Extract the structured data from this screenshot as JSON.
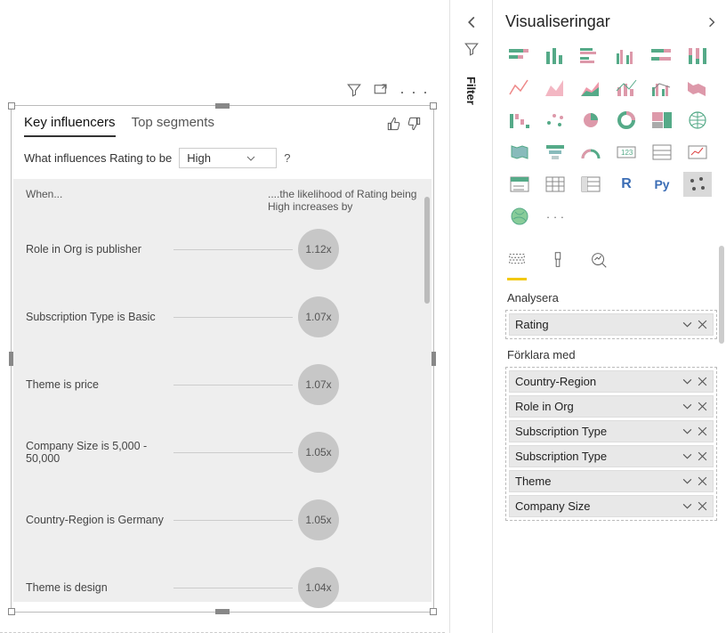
{
  "visual": {
    "tabs": {
      "key_influencers": "Key influencers",
      "top_segments": "Top segments"
    },
    "question_prefix": "What influences Rating to be",
    "dropdown_value": "High",
    "header_left": "When...",
    "header_right": "....the likelihood of Rating being High increases by",
    "rows": [
      {
        "label": "Role in Org is publisher",
        "value": "1.12x"
      },
      {
        "label": "Subscription Type is Basic",
        "value": "1.07x"
      },
      {
        "label": "Theme is price",
        "value": "1.07x"
      },
      {
        "label": "Company Size is 5,000 - 50,000",
        "value": "1.05x"
      },
      {
        "label": "Country-Region is Germany",
        "value": "1.05x"
      },
      {
        "label": "Theme is design",
        "value": "1.04x"
      }
    ]
  },
  "filter": {
    "label": "Filter"
  },
  "viz": {
    "title": "Visualiseringar",
    "analyze_label": "Analysera",
    "explain_label": "Förklara med",
    "analyze_fields": [
      "Rating"
    ],
    "explain_fields": [
      "Country-Region",
      "Role in Org",
      "Subscription Type",
      "Subscription Type",
      "Theme",
      "Company Size"
    ],
    "r_label": "R",
    "py_label": "Py",
    "more": "· · ·"
  }
}
